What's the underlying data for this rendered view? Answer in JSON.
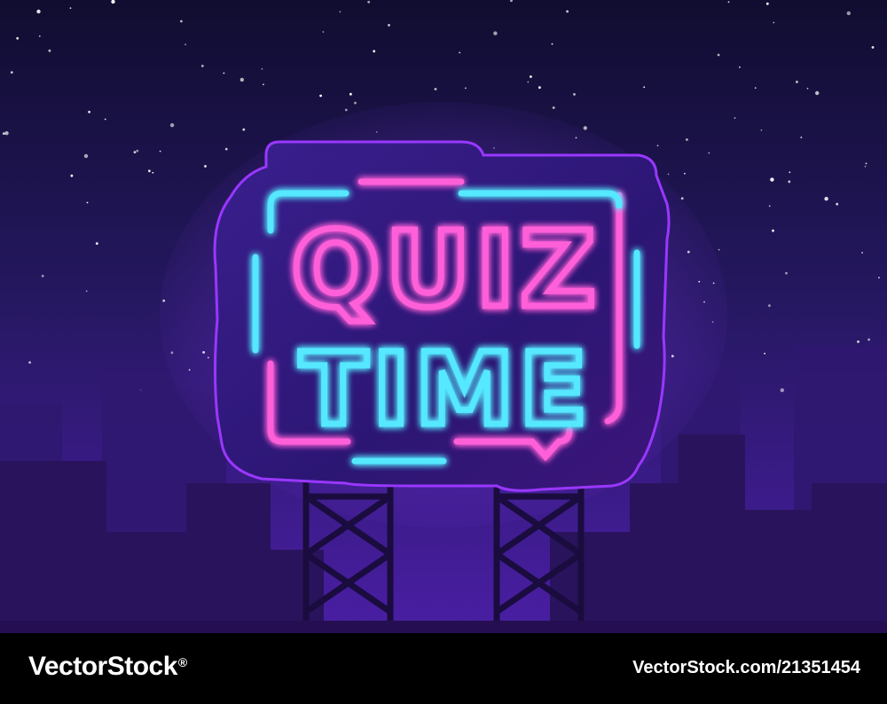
{
  "sign": {
    "line1": "QUIZ",
    "line2": "TIME"
  },
  "watermark": {
    "brand": "VectorStock",
    "mark": "®",
    "image_id": "VectorStock.com/21351454"
  },
  "colors": {
    "sky_top": "#120f36",
    "sky_bottom": "#3b1b8c",
    "neon_pink": "#ff4fd8",
    "neon_blue": "#4fe6ff",
    "sign_panel": "#2a1670",
    "sign_edge": "#c43cff",
    "city": "#2c1866"
  }
}
